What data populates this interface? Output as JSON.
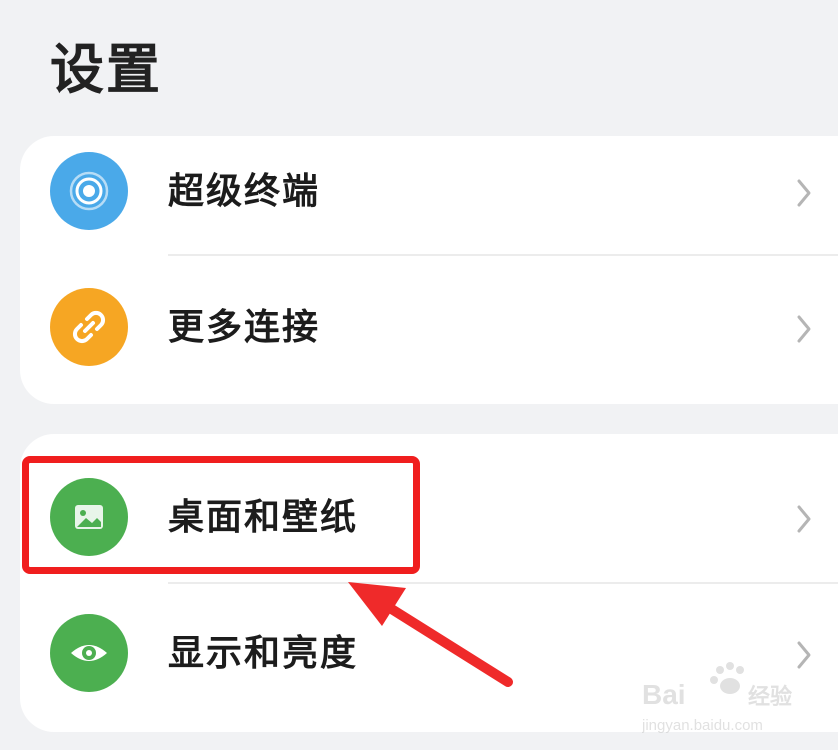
{
  "header": {
    "title": "设置"
  },
  "groups": [
    {
      "items": [
        {
          "label": "超级终端",
          "icon": "super-device-icon",
          "color": "#4aa9e9"
        },
        {
          "label": "更多连接",
          "icon": "link-icon",
          "color": "#f6a623"
        }
      ]
    },
    {
      "items": [
        {
          "label": "桌面和壁纸",
          "icon": "image-icon",
          "color": "#4caf50"
        },
        {
          "label": "显示和亮度",
          "icon": "eye-icon",
          "color": "#4caf50"
        }
      ]
    }
  ],
  "annotation": {
    "highlight_color": "#f01e1e",
    "highlighted_item": "桌面和壁纸"
  },
  "watermark": {
    "brand": "Bai",
    "brand_suffix": "经验",
    "site": "jingyan.baidu.com"
  }
}
